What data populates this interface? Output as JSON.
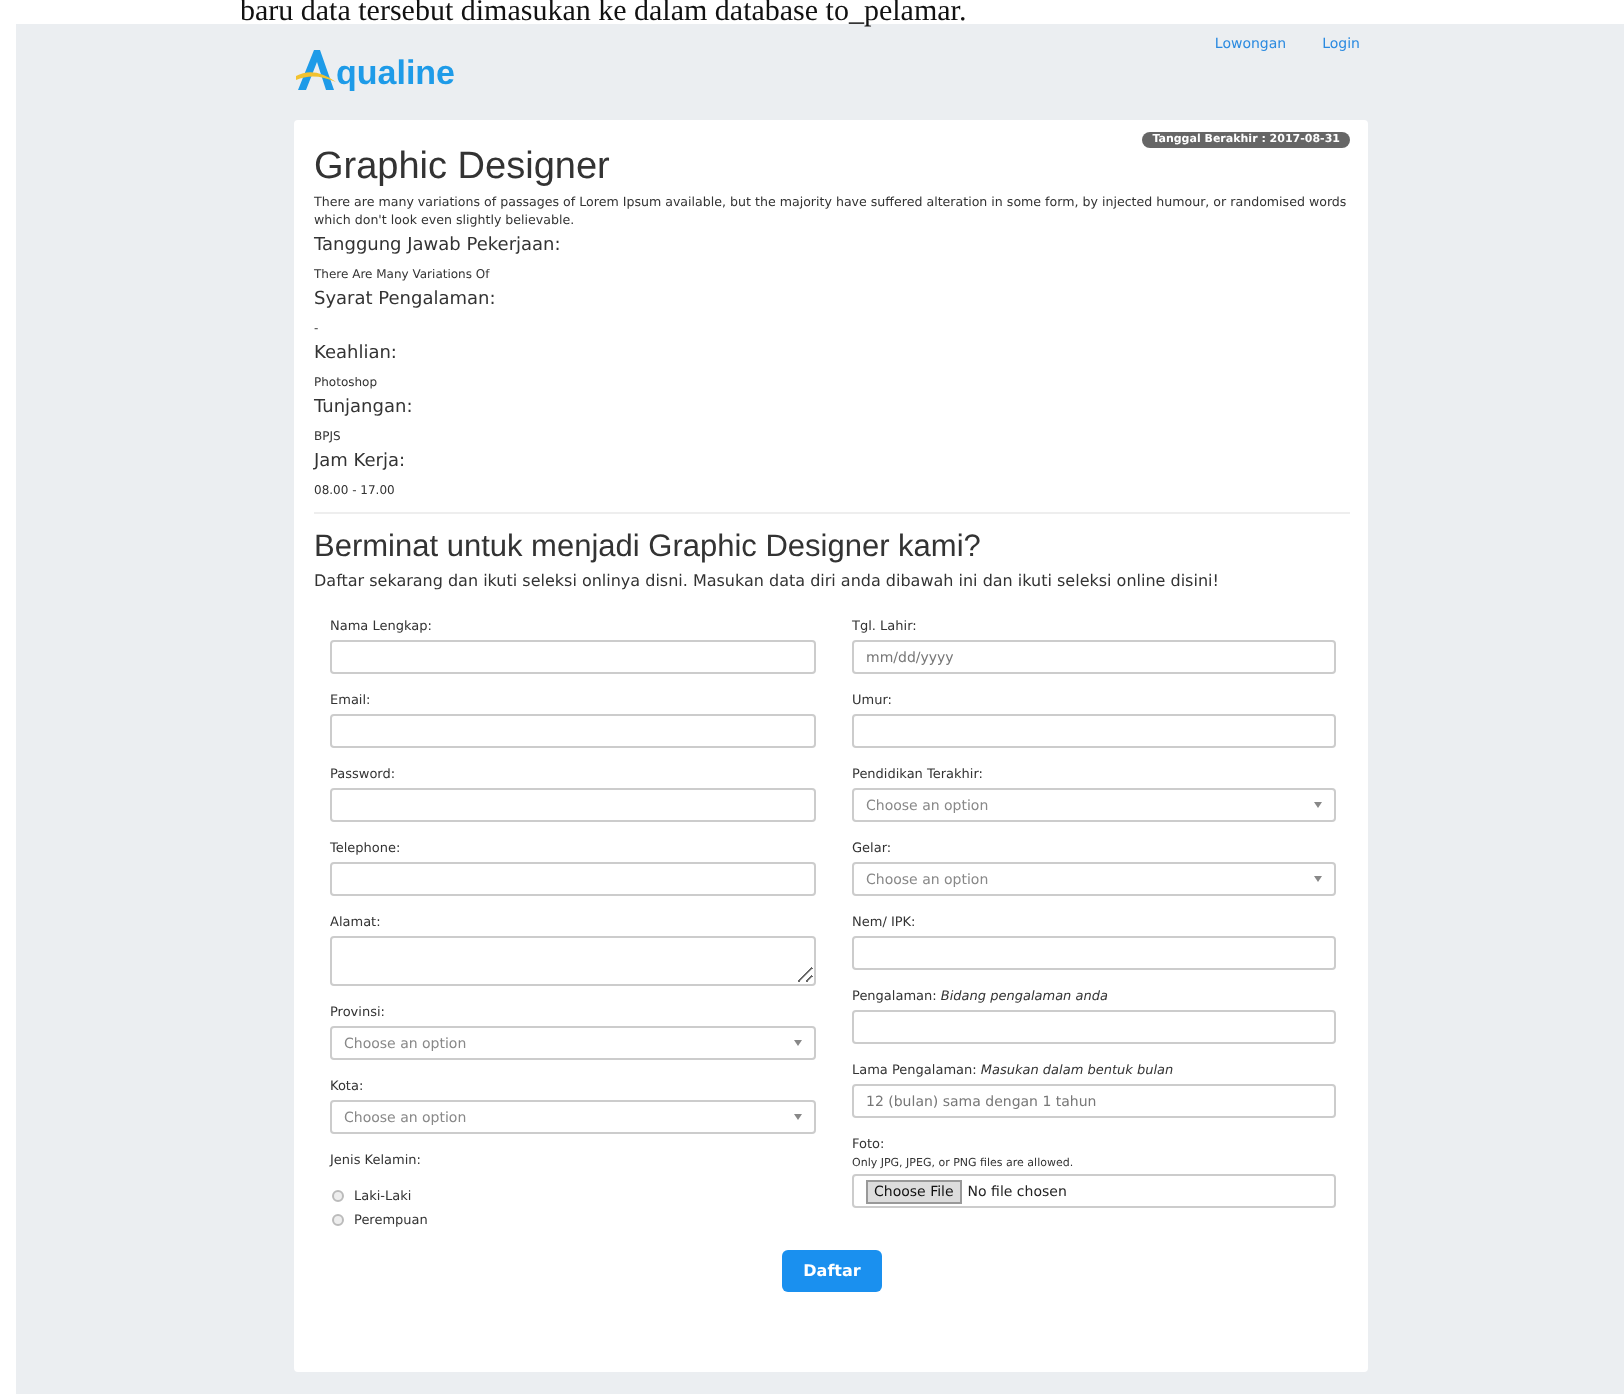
{
  "document_line": "baru data tersebut dimasukan ke dalam database to_pelamar.",
  "header": {
    "logo": "qualine",
    "nav": [
      {
        "label": "Lowongan"
      },
      {
        "label": "Login"
      }
    ]
  },
  "job": {
    "deadline": "Tanggal Berakhir : 2017-08-31",
    "title": "Graphic Designer",
    "description": "There are many variations of passages of Lorem Ipsum available, but the majority have suffered alteration in some form, by injected humour, or randomised words which don't look even slightly believable.",
    "sections": [
      {
        "heading": "Tanggung Jawab Pekerjaan:",
        "text": "There Are Many Variations Of"
      },
      {
        "heading": "Syarat Pengalaman:",
        "text": "-"
      },
      {
        "heading": "Keahlian:",
        "text": "Photoshop"
      },
      {
        "heading": "Tunjangan:",
        "text": "BPJS"
      },
      {
        "heading": "Jam Kerja:",
        "text": "08.00 - 17.00"
      }
    ]
  },
  "apply": {
    "title": "Berminat untuk menjadi Graphic Designer kami?",
    "subtitle": "Daftar sekarang dan ikuti seleksi onlinya disni. Masukan data diri anda dibawah ini dan ikuti seleksi online disini!",
    "left_fields": [
      {
        "kind": "text",
        "label": "Nama Lengkap:"
      },
      {
        "kind": "text",
        "label": "Email:"
      },
      {
        "kind": "text",
        "label": "Password:"
      },
      {
        "kind": "text",
        "label": "Telephone:"
      },
      {
        "kind": "textarea",
        "label": "Alamat:"
      },
      {
        "kind": "select",
        "label": "Provinsi:",
        "placeholder": "Choose an option"
      },
      {
        "kind": "select",
        "label": "Kota:",
        "placeholder": "Choose an option"
      },
      {
        "kind": "radio",
        "label": "Jenis Kelamin:",
        "options": [
          {
            "label": "Laki-Laki",
            "selected": false
          },
          {
            "label": "Perempuan",
            "selected": false
          }
        ]
      }
    ],
    "right_fields": [
      {
        "kind": "text",
        "label": "Tgl. Lahir:",
        "placeholder": "mm/dd/yyyy"
      },
      {
        "kind": "text",
        "label": "Umur:"
      },
      {
        "kind": "select",
        "label": "Pendidikan Terakhir:",
        "placeholder": "Choose an option"
      },
      {
        "kind": "select",
        "label": "Gelar:",
        "placeholder": "Choose an option"
      },
      {
        "kind": "text",
        "label": "Nem/ IPK:"
      },
      {
        "kind": "text",
        "label": "Pengalaman: *Bidang pengalaman anda*"
      },
      {
        "kind": "text",
        "label": "Lama Pengalaman: *Masukan dalam bentuk bulan*",
        "placeholder": "12 (bulan) sama dengan 1 tahun"
      },
      {
        "kind": "file",
        "label": "Foto:",
        "note": "Only JPG, JPEG, or PNG files are allowed.",
        "button": "Choose File",
        "status": "No file chosen"
      }
    ],
    "submit": "Daftar"
  }
}
